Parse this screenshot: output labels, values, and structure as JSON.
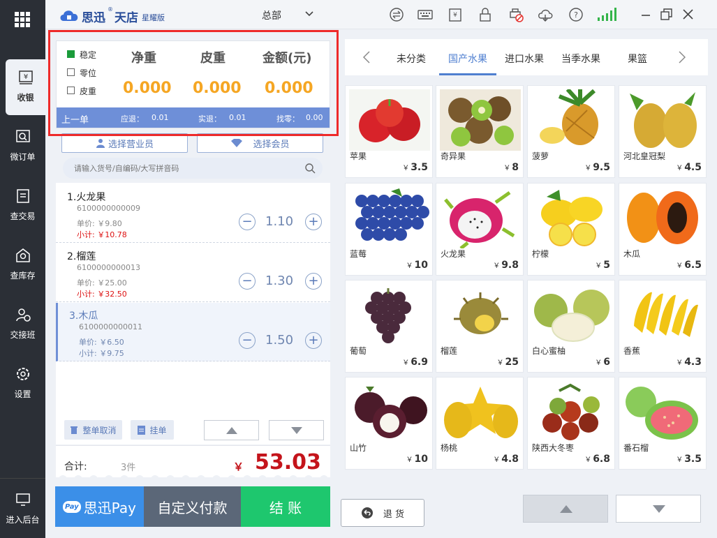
{
  "app": {
    "logo_name": "思迅",
    "logo_tian": "天店",
    "edition": "星耀版",
    "store": "总部"
  },
  "sidebar": {
    "items": [
      {
        "label": "收银",
        "icon": "yen-register-icon"
      },
      {
        "label": "微订单",
        "icon": "micro-order-icon"
      },
      {
        "label": "查交易",
        "icon": "transaction-icon"
      },
      {
        "label": "查库存",
        "icon": "inventory-icon"
      },
      {
        "label": "交接班",
        "icon": "shift-handover-icon"
      },
      {
        "label": "设置",
        "icon": "gear-icon"
      }
    ],
    "bottom_label": "进入后台"
  },
  "scale": {
    "options": [
      "稳定",
      "零位",
      "皮重"
    ],
    "headers": [
      "净重",
      "皮重",
      "金额(元)"
    ],
    "values": [
      "0.000",
      "0.000",
      "0.000"
    ]
  },
  "last_order": {
    "label": "上一单",
    "due_label": "应退：",
    "due": "0.01",
    "paid_label": "实退：",
    "paid": "0.01",
    "change_label": "找零：",
    "change": "0.00"
  },
  "buttons": {
    "select_staff": "选择营业员",
    "select_member": "选择会员",
    "cancel_order": "整单取消",
    "hold_order": "挂单",
    "refund": "退 货"
  },
  "search": {
    "placeholder": "请输入货号/自编码/大写拼音码"
  },
  "cart": [
    {
      "name": "1.火龙果",
      "code": "6100000000009",
      "unit_price": "单价: ￥9.80",
      "subtotal": "小计: ￥10.78",
      "qty": "1.10"
    },
    {
      "name": "2.榴莲",
      "code": "6100000000013",
      "unit_price": "单价: ￥25.00",
      "subtotal": "小计: ￥32.50",
      "qty": "1.30"
    },
    {
      "name": "3.木瓜",
      "code": "6100000000011",
      "unit_price": "单价: ￥6.50",
      "subtotal": "小计: ￥9.75",
      "qty": "1.50"
    }
  ],
  "total": {
    "label": "合计:",
    "count": "3件",
    "currency": "￥",
    "amount": "53.03"
  },
  "pay": {
    "pay_badge": "Pay",
    "sixun_pay": "思迅Pay",
    "custom_pay": "自定义付款",
    "checkout": "结 账"
  },
  "categories": [
    "未分类",
    "国产水果",
    "进口水果",
    "当季水果",
    "果篮"
  ],
  "active_category": "国产水果",
  "currency": "￥",
  "products": [
    {
      "name": "苹果",
      "price": "3.5"
    },
    {
      "name": "奇异果",
      "price": "8"
    },
    {
      "name": "菠萝",
      "price": "9.5"
    },
    {
      "name": "河北皇冠梨",
      "price": "4.5"
    },
    {
      "name": "蓝莓",
      "price": "10"
    },
    {
      "name": "火龙果",
      "price": "9.8"
    },
    {
      "name": "柠檬",
      "price": "5"
    },
    {
      "name": "木瓜",
      "price": "6.5"
    },
    {
      "name": "葡萄",
      "price": "6.9"
    },
    {
      "name": "榴莲",
      "price": "25"
    },
    {
      "name": "白心蜜柚",
      "price": "6"
    },
    {
      "name": "香蕉",
      "price": "4.3"
    },
    {
      "name": "山竹",
      "price": "10"
    },
    {
      "name": "杨桃",
      "price": "4.8"
    },
    {
      "name": "陕西大冬枣",
      "price": "6.8"
    },
    {
      "name": "番石榴",
      "price": "3.5"
    }
  ],
  "colors": {
    "accent": "#4f7fd0",
    "checkout_green": "#1ec76e",
    "custom_pay_gray": "#5b6778",
    "sixun_pay_blue": "#3b8fe8",
    "total_red": "#c4141b",
    "weight_orange": "#f5a623",
    "highlight_red": "#ee2a2a"
  }
}
